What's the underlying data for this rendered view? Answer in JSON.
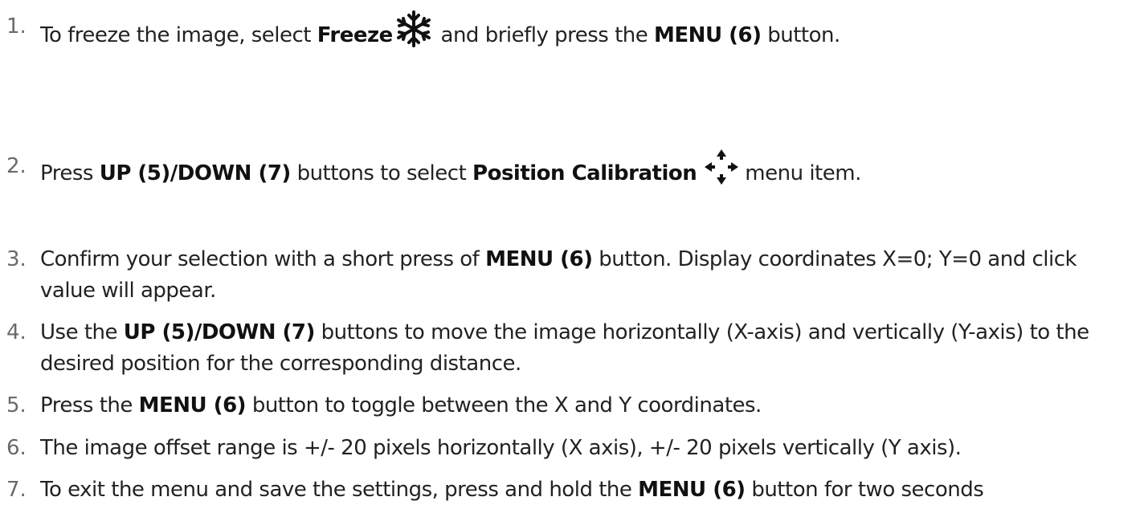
{
  "steps": [
    {
      "number": "1.",
      "t1": "To freeze the image, select ",
      "b1": "Freeze",
      "icon": "snowflake-icon",
      "t2": " and briefly press the ",
      "b2": "MENU (6)",
      "t3": " button."
    },
    {
      "number": "2.",
      "t1": "Press ",
      "b1": "UP (5)/DOWN (7)",
      "t2": " buttons to select ",
      "b2": "Position Calibration",
      "icon": "move-arrows-icon",
      "t3": " menu item."
    },
    {
      "number": "3.",
      "t1": "Confirm your selection with a short press of ",
      "b1": "MENU (6)",
      "t2": " button. Display coordinates X=0; Y=0 and click",
      "line2": "value will appear."
    },
    {
      "number": "4.",
      "t1": "Use the ",
      "b1": "UP (5)/DOWN (7)",
      "t2": " buttons to move the image horizontally (X-axis) and vertically (Y-axis) to the",
      "line2": "desired position for the corresponding distance."
    },
    {
      "number": "5.",
      "t1": "Press the ",
      "b1": "MENU (6)",
      "t2": " button to toggle between the X and Y coordinates."
    },
    {
      "number": "6.",
      "t1": "The image offset range is +/- 20 pixels horizontally (X axis), +/- 20 pixels vertically (Y axis)."
    },
    {
      "number": "7.",
      "t1": "To exit the menu and save the settings, press and hold the ",
      "b1": "MENU (6)",
      "t2": " button for two seconds"
    }
  ]
}
